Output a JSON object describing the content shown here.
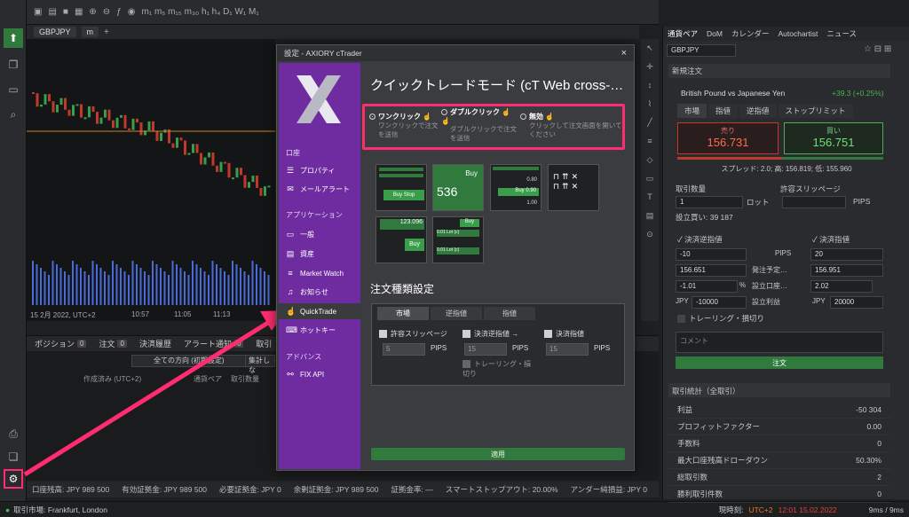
{
  "colors": {
    "accent_pink": "#ff2d6f",
    "purple": "#6f2ca0",
    "green": "#2f7a3c",
    "red_bar": "#c0392b"
  },
  "left_rail": {
    "icons": [
      "chart-up-icon",
      "copy-icon",
      "window-icon",
      "zoom-icon",
      "print-icon",
      "layers-icon",
      "gear-icon",
      "help-icon"
    ]
  },
  "chart_tabs": {
    "symbol": "GBPJPY",
    "tf": "m",
    "add": "+"
  },
  "chart": {
    "date_label": "15 2月 2022, UTC+2",
    "time_ticks": [
      "10:57",
      "11:05",
      "11:13"
    ]
  },
  "bottom_tabs": [
    {
      "label": "ポジション",
      "count": "0"
    },
    {
      "label": "注文",
      "count": "0"
    },
    {
      "label": "決済履歴",
      "count": ""
    },
    {
      "label": "アラート通知",
      "count": "0"
    },
    {
      "label": "取引",
      "count": ""
    }
  ],
  "bottom_filter": {
    "direction": "全ての方向 (初期設定)",
    "group": "集計しな"
  },
  "bottom_columns": [
    "作成済み (UTC+2)",
    "通貨ペア",
    "取引数量"
  ],
  "status_bar": [
    "口座残高: JPY 989 500",
    "有効証拠金: JPY 989 500",
    "必要証拠金: JPY 0",
    "余剰証拠金: JPY 989 500",
    "証拠金率: —",
    "スマートストップアウト: 20.00%",
    "アンダー純損益: JPY 0"
  ],
  "footer": {
    "market": "取引市場: Frankfurt, London",
    "time_label": "現時刻:",
    "tz": "UTC+2",
    "datetime": "12:01 15.02.2022",
    "latency": "9ms / 9ms"
  },
  "right_panel": {
    "tabs": [
      "通貨ペア",
      "DoM",
      "カレンダー",
      "Autochartist",
      "ニュース"
    ],
    "symbol": "GBPJPY",
    "new_order_title": "新規注文",
    "pair_name": "British Pound vs Japanese Yen",
    "change": "+39.3 (+0.25%)",
    "order_types": [
      "市場",
      "指値",
      "逆指値",
      "ストップリミット"
    ],
    "sell_label": "売り",
    "sell_price": "156.731",
    "buy_label": "買い",
    "buy_price": "156.751",
    "spread": "スプレッド: 2.0; 高: 156.819; 低: 155.960",
    "qty_label": "取引数量",
    "qty_value": "1",
    "lot": "ロット",
    "slippage_label": "許容スリッページ",
    "pips": "PIPS",
    "set_buy": "設立買い: 39 187",
    "sl_label": "決済逆指値",
    "tp_label": "決済指値",
    "sl_pips": "-10",
    "tp_pips": "20",
    "sl_price": "156.651",
    "issue_label": "発注予定…",
    "tp_price": "156.951",
    "sl_pct": "-1.01",
    "pct": "%",
    "set_acct": "設立口座…",
    "tp_pct": "2.02",
    "jpy": "JPY",
    "sl_jpy": "-10000",
    "set_profit": "設立利益",
    "tp_jpy": "20000",
    "trailing": "トレーリング・損切り",
    "comment": "コメント",
    "order_btn": "注文",
    "stats_title": "取引統計（全取引）",
    "stats": [
      {
        "k": "利益",
        "v": "-50 304"
      },
      {
        "k": "プロフィットファクター",
        "v": "0.00"
      },
      {
        "k": "手数料",
        "v": "0"
      },
      {
        "k": "最大口座残高ドローダウン",
        "v": "50.30%"
      },
      {
        "k": "総取引数",
        "v": "2"
      },
      {
        "k": "勝利取引件数",
        "v": "0"
      }
    ]
  },
  "dialog": {
    "title": "設定 - AXIORY cTrader",
    "close": "×",
    "heading": "クイックトレードモード (cT Web cross-…",
    "sections": {
      "account": "口座",
      "app": "アプリケーション",
      "advanced": "アドバンス"
    },
    "sidebar": {
      "properties": "プロパティ",
      "mail": "メールアラート",
      "general": "一般",
      "assets": "資産",
      "market_watch": "Market Watch",
      "notice": "お知らせ",
      "quicktrade": "QuickTrade",
      "hotkey": "ホットキー",
      "fix": "FIX API"
    },
    "modes": [
      {
        "name": "ワンクリック",
        "desc": "ワンクリックで注文を送信"
      },
      {
        "name": "ダブルクリック",
        "desc": "ダブルクリックで注文を送信"
      },
      {
        "name": "無効",
        "desc": "クリックして注文画面を開いてください"
      }
    ],
    "thumbs": {
      "t1_label": "Buy Stop",
      "t2_buy": "Buy",
      "t2_num": "536",
      "t3_a": "0.80",
      "t3_b": "Buy 0.90",
      "t3_c": "1.00",
      "t5_price": "123.096",
      "t5_buy": "Buy",
      "t6_buy": "Buy",
      "t6_a": "0.01 Lot (c)",
      "t6_b": "0.01 Lot (c)"
    },
    "order_types_title": "注文種類設定",
    "order_tabs": [
      "市場",
      "逆指値",
      "指値"
    ],
    "slippage": "許容スリッページ",
    "sl": "決済逆指値",
    "tp": "決済指値",
    "trailing": "トレーリング・損切り",
    "val5": "5",
    "val15a": "15",
    "val15b": "15",
    "pips": "PIPS",
    "apply": "適用"
  }
}
